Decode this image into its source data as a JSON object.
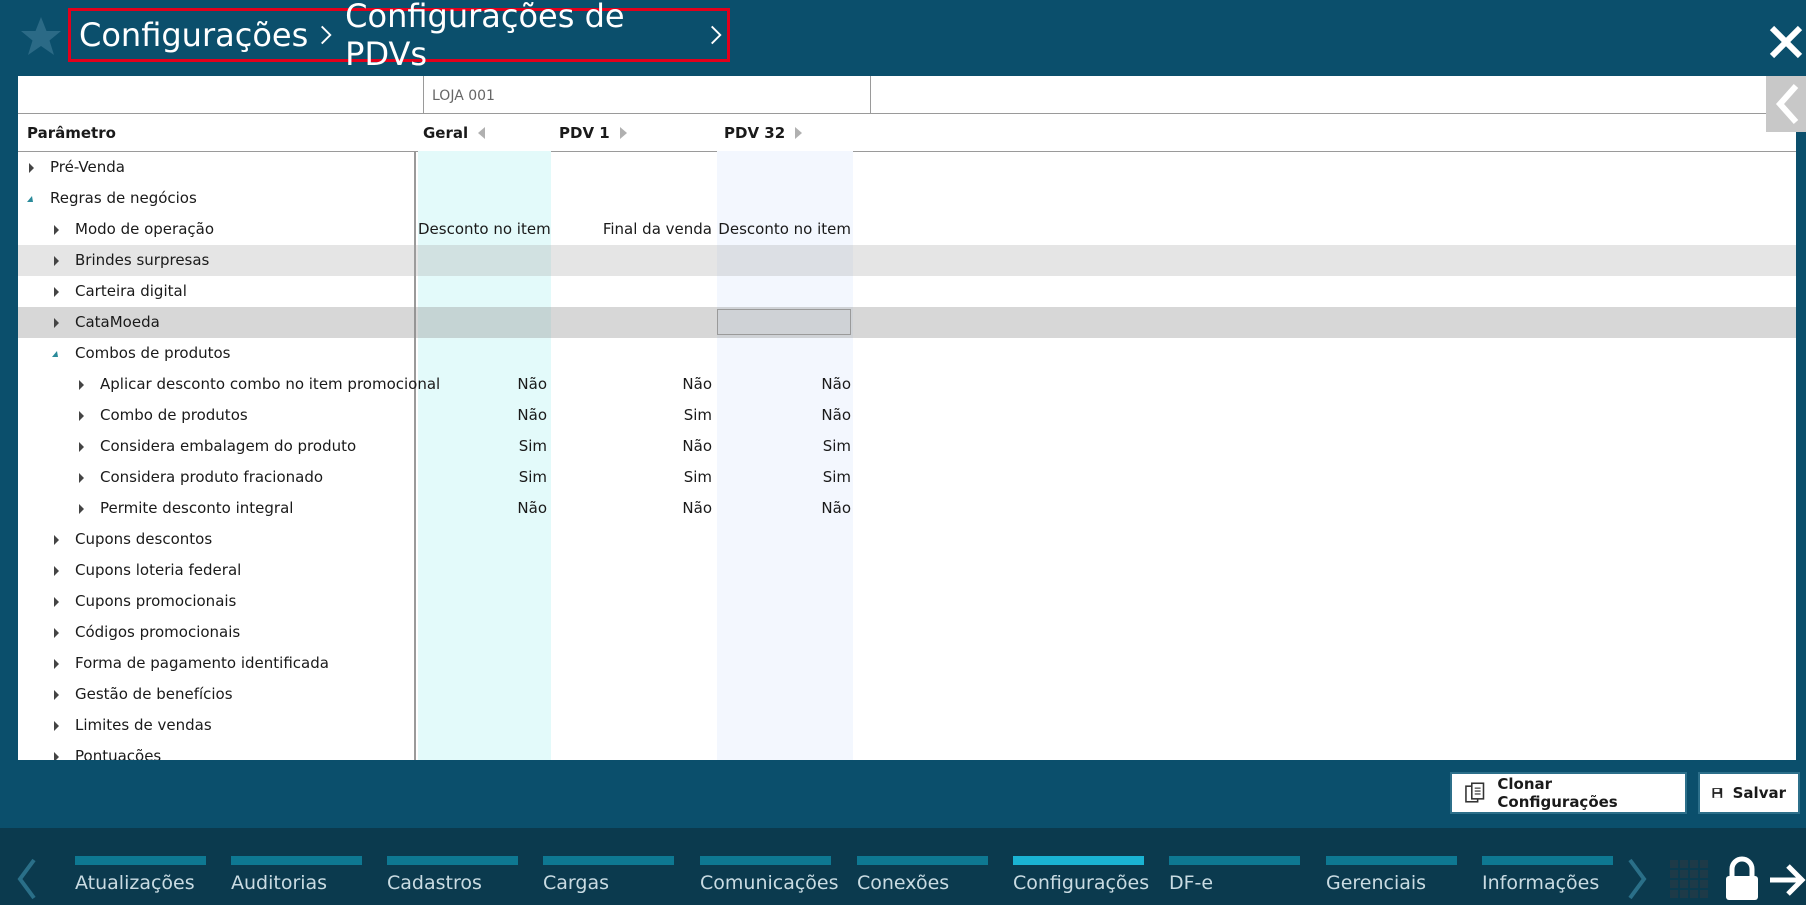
{
  "breadcrumb": {
    "items": [
      "Configurações",
      "Configurações de PDVs"
    ]
  },
  "grid": {
    "store_label": "LOJA 001",
    "headers": {
      "param": "Parâmetro",
      "geral": "Geral",
      "pdv1": "PDV 1",
      "pdv32": "PDV 32"
    },
    "rows": [
      {
        "label": "Pré-Venda",
        "geral": "",
        "pdv1": "",
        "pdv32": ""
      },
      {
        "label": "Regras de negócios",
        "geral": "",
        "pdv1": "",
        "pdv32": ""
      },
      {
        "label": "Modo de operação",
        "geral": "Desconto no item",
        "pdv1": "Final da venda",
        "pdv32": "Desconto no item"
      },
      {
        "label": "Brindes surpresas",
        "geral": "",
        "pdv1": "",
        "pdv32": ""
      },
      {
        "label": "Carteira digital",
        "geral": "",
        "pdv1": "",
        "pdv32": ""
      },
      {
        "label": "CataMoeda",
        "geral": "",
        "pdv1": "",
        "pdv32": ""
      },
      {
        "label": "Combos de produtos",
        "geral": "",
        "pdv1": "",
        "pdv32": ""
      },
      {
        "label": "Aplicar desconto combo no item promocional",
        "geral": "Não",
        "pdv1": "Não",
        "pdv32": "Não"
      },
      {
        "label": "Combo de produtos",
        "geral": "Não",
        "pdv1": "Sim",
        "pdv32": "Não"
      },
      {
        "label": "Considera embalagem do produto",
        "geral": "Sim",
        "pdv1": "Não",
        "pdv32": "Sim"
      },
      {
        "label": "Considera produto fracionado",
        "geral": "Sim",
        "pdv1": "Sim",
        "pdv32": "Sim"
      },
      {
        "label": "Permite desconto integral",
        "geral": "Não",
        "pdv1": "Não",
        "pdv32": "Não"
      },
      {
        "label": "Cupons descontos",
        "geral": "",
        "pdv1": "",
        "pdv32": ""
      },
      {
        "label": "Cupons loteria federal",
        "geral": "",
        "pdv1": "",
        "pdv32": ""
      },
      {
        "label": "Cupons promocionais",
        "geral": "",
        "pdv1": "",
        "pdv32": ""
      },
      {
        "label": "Códigos promocionais",
        "geral": "",
        "pdv1": "",
        "pdv32": ""
      },
      {
        "label": "Forma de pagamento identificada",
        "geral": "",
        "pdv1": "",
        "pdv32": ""
      },
      {
        "label": "Gestão de benefícios",
        "geral": "",
        "pdv1": "",
        "pdv32": ""
      },
      {
        "label": "Limites de vendas",
        "geral": "",
        "pdv1": "",
        "pdv32": ""
      },
      {
        "label": "Pontuações",
        "geral": "",
        "pdv1": "",
        "pdv32": ""
      }
    ]
  },
  "actions": {
    "clone_label": "Clonar Configurações",
    "save_label": "Salvar"
  },
  "bottom_nav": {
    "tabs": [
      "Atualizações",
      "Auditorias",
      "Cadastros",
      "Cargas",
      "Comunicações",
      "Conexões",
      "Configurações",
      "DF-e",
      "Gerenciais",
      "Informações"
    ],
    "active": "Configurações"
  },
  "colors": {
    "background": "#0b4f6c",
    "breadcrumb_highlight": "#e3001b",
    "active_tab": "#1ab3d3",
    "tab": "#0e7892"
  }
}
